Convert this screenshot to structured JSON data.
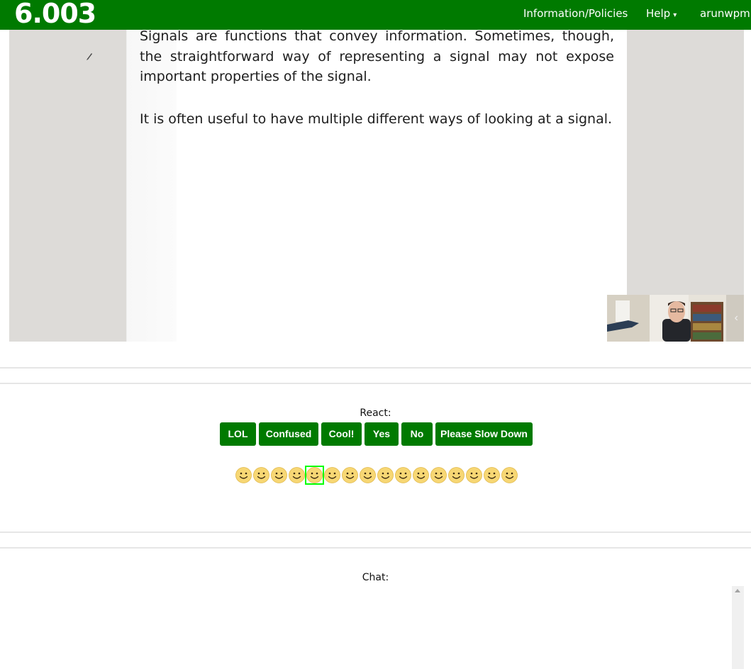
{
  "navbar": {
    "brand": "6.003",
    "items": [
      {
        "label": "Information/Policies"
      },
      {
        "label": "Help",
        "caret": "▾"
      },
      {
        "label": "arunwpm",
        "caret": "▾"
      }
    ],
    "color": "#007a00"
  },
  "slide": {
    "paragraphs": [
      "Signals are functions that convey information. Sometimes, though, the straightforward way of representing a signal may not expose important properties of the signal.",
      "It is often useful to have multiple different ways of looking at a signal."
    ],
    "video_chevron": "‹"
  },
  "react": {
    "label": "React:",
    "buttons": [
      "LOL",
      "Confused",
      "Cool!",
      "Yes",
      "No",
      "Please Slow Down"
    ],
    "smiley_count": 16,
    "active_index": 4
  },
  "chat": {
    "label": "Chat:"
  }
}
